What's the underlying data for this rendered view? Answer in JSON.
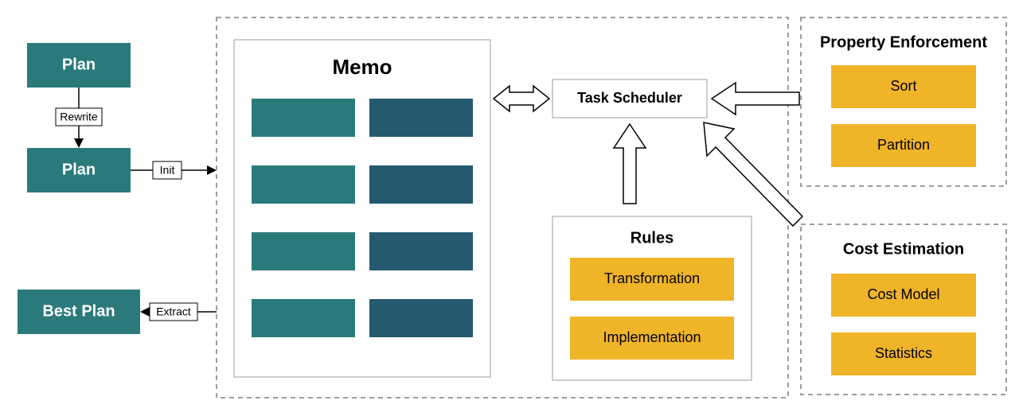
{
  "left": {
    "plan1": "Plan",
    "plan2": "Plan",
    "best_plan": "Best Plan",
    "rewrite_label": "Rewrite",
    "init_label": "Init",
    "extract_label": "Extract"
  },
  "memo": {
    "title": "Memo"
  },
  "scheduler": {
    "title": "Task Scheduler"
  },
  "rules": {
    "title": "Rules",
    "transformation": "Transformation",
    "implementation": "Implementation"
  },
  "property_enforcement": {
    "title": "Property Enforcement",
    "sort": "Sort",
    "partition": "Partition"
  },
  "cost_estimation": {
    "title": "Cost Estimation",
    "cost_model": "Cost Model",
    "statistics": "Statistics"
  }
}
